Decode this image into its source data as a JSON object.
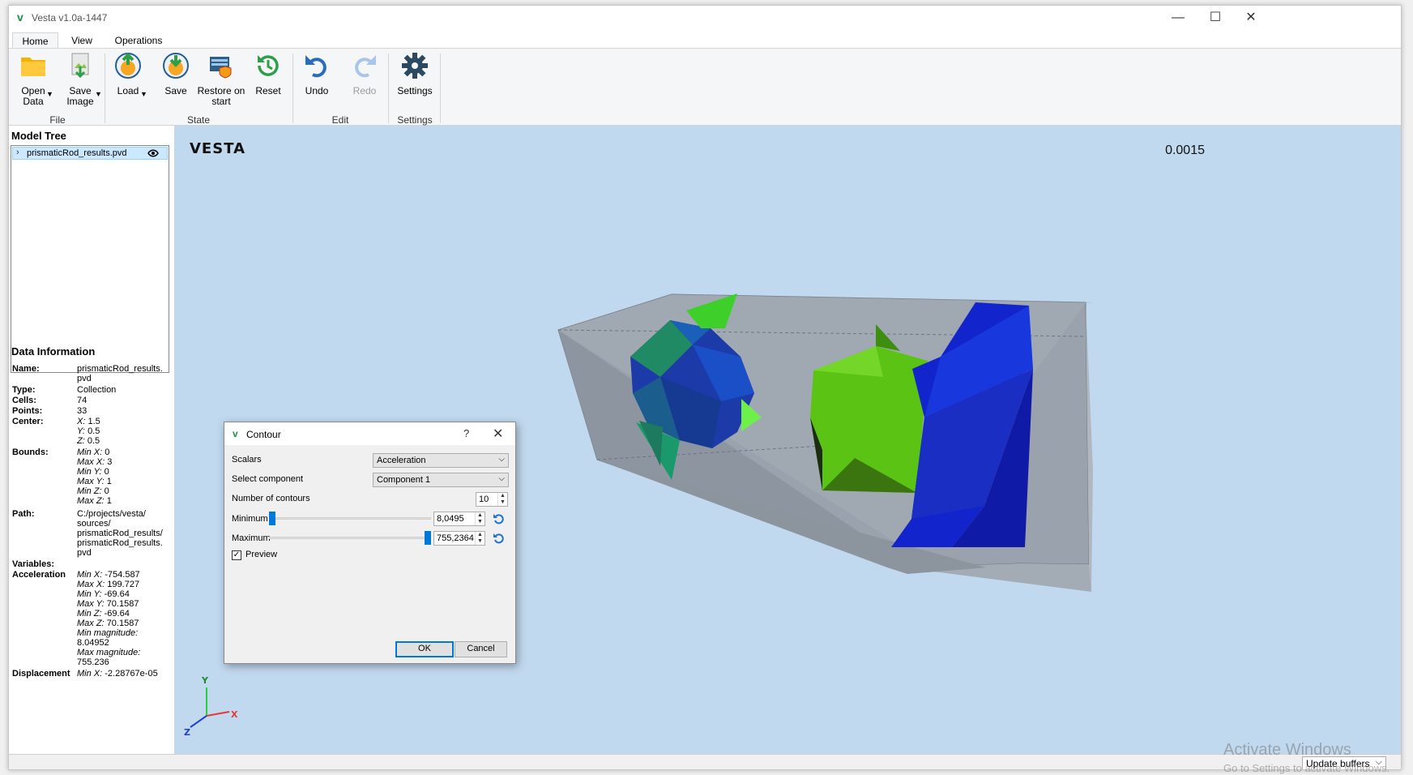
{
  "window": {
    "title": "Vesta v1.0a-1447"
  },
  "tabs": [
    {
      "label": "Home"
    },
    {
      "label": "View"
    },
    {
      "label": "Operations"
    }
  ],
  "ribbon": {
    "open_data": "Open Data",
    "save_image": "Save Image",
    "load": "Load",
    "save": "Save",
    "restore_line1": "Restore on",
    "restore_line2": "start",
    "reset": "Reset",
    "undo": "Undo",
    "redo": "Redo",
    "settings": "Settings",
    "groups": {
      "file": "File",
      "state": "State",
      "edit": "Edit",
      "settings": "Settings"
    }
  },
  "model_tree": {
    "title": "Model Tree",
    "item": "prismaticRod_results.pvd"
  },
  "data_info": {
    "title": "Data Information",
    "name_k": "Name:",
    "name_v1": "prismaticRod_results.",
    "name_v2": "pvd",
    "type_k": "Type:",
    "type_v": "Collection",
    "cells_k": "Cells:",
    "cells_v": "74",
    "points_k": "Points:",
    "points_v": "33",
    "center_k": "Center:",
    "center": [
      {
        "k": "X:",
        "v": "1.5"
      },
      {
        "k": "Y:",
        "v": "0.5"
      },
      {
        "k": "Z:",
        "v": "0.5"
      }
    ],
    "bounds_k": "Bounds:",
    "bounds": [
      {
        "k": "Min X:",
        "v": "0"
      },
      {
        "k": "Max X:",
        "v": "3"
      },
      {
        "k": "Min Y:",
        "v": "0"
      },
      {
        "k": "Max Y:",
        "v": "1"
      },
      {
        "k": "Min Z:",
        "v": "0"
      },
      {
        "k": "Max Z:",
        "v": "1"
      }
    ],
    "path_k": "Path:",
    "path": [
      "C:/projects/vesta/",
      "sources/",
      "prismaticRod_results/",
      "prismaticRod_results.",
      "pvd"
    ],
    "variables_k": "Variables:",
    "accel_k": "Acceleration",
    "accel": [
      {
        "k": "Min X:",
        "v": "-754.587"
      },
      {
        "k": "Max X:",
        "v": "199.727"
      },
      {
        "k": "Min Y:",
        "v": "-69.64"
      },
      {
        "k": "Max Y:",
        "v": "70.1587"
      },
      {
        "k": "Min Z:",
        "v": "-69.64"
      },
      {
        "k": "Max Z:",
        "v": "70.1587"
      },
      {
        "k": "Min magnitude:",
        "v": ""
      },
      {
        "k": "",
        "v": "8.04952"
      },
      {
        "k": "Max magnitude:",
        "v": ""
      },
      {
        "k": "",
        "v": "755.236"
      }
    ],
    "disp_k": "Displacement",
    "disp_v_k": "Min X:",
    "disp_v": "-2.28767e-05"
  },
  "viewport": {
    "logo": "VESTA",
    "time": "0.0015"
  },
  "contour_dialog": {
    "title": "Contour",
    "help": "?",
    "scalars_label": "Scalars",
    "scalars_value": "Acceleration",
    "component_label": "Select component",
    "component_value": "Component 1",
    "contours_label": "Number of contours",
    "contours_value": "10",
    "min_label": "Minimum",
    "min_value": "8,0495",
    "min_fraction": 0.0,
    "max_label": "Maximum",
    "max_value": "755,2364",
    "max_fraction": 1.0,
    "preview_label": "Preview",
    "preview_checked": true,
    "ok": "OK",
    "cancel": "Cancel"
  },
  "status": {
    "update_buffers": "Update buffers"
  },
  "watermark": {
    "line1": "Activate Windows",
    "line2": "Go to Settings to activate Windows."
  },
  "colors": {
    "viewport_bg": "#c1d9ef",
    "accent": "#0078d7",
    "selection": "#cce8ff"
  }
}
